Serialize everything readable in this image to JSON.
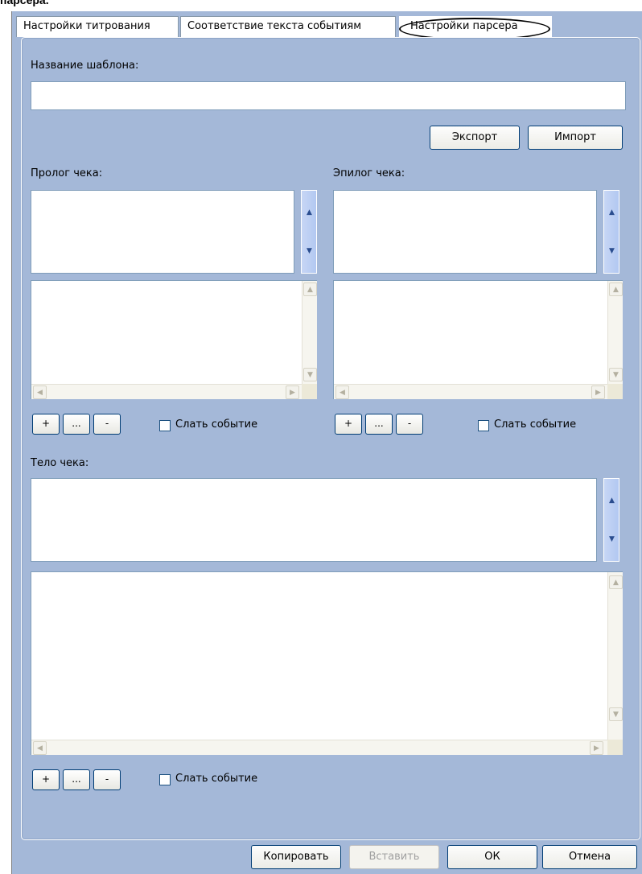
{
  "caption": "парсера.",
  "tabs": [
    {
      "label": "Настройки титрования"
    },
    {
      "label": "Соответствие текста событиям"
    },
    {
      "label": "Настройки парсера"
    }
  ],
  "template": {
    "label": "Название шаблона:",
    "value": ""
  },
  "buttons": {
    "export": "Экспорт",
    "import": "Импорт",
    "add": "+",
    "edit": "...",
    "remove": "-"
  },
  "prologue": {
    "label": "Пролог чека:",
    "send_event": "Слать событие",
    "checked": false
  },
  "epilogue": {
    "label": "Эпилог чека:",
    "send_event": "Слать событие",
    "checked": false
  },
  "body": {
    "label": "Тело чека:",
    "send_event": "Слать событие",
    "checked": false
  },
  "icons": {
    "up": "▲",
    "down": "▼",
    "left": "◀",
    "right": "▶"
  },
  "footer": {
    "copy": "Копировать",
    "paste": "Вставить",
    "ok": "ОК",
    "cancel": "Отмена"
  }
}
